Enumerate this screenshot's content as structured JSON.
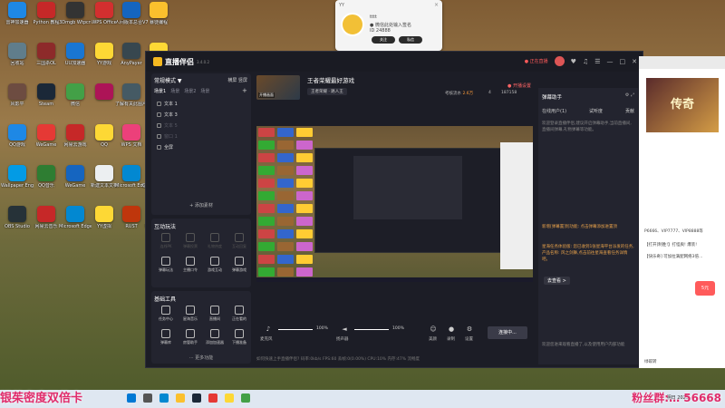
{
  "desktop_icons": [
    {
      "label": "雷神加速器",
      "color": "#1e88e5"
    },
    {
      "label": "Python 教程",
      "color": "#c62828"
    },
    {
      "label": "3Dmgb Wtpcn",
      "color": "#333333"
    },
    {
      "label": "WPS Office",
      "color": "#d32f2f"
    },
    {
      "label": "人间版本总合V7",
      "color": "#1565c0"
    },
    {
      "label": "暴徒编程",
      "color": "#fbc02d"
    },
    {
      "label": "回收站",
      "color": "#607d8b"
    },
    {
      "label": "三国杀OL",
      "color": "#8d2a2a"
    },
    {
      "label": "UU加速器",
      "color": "#1976d2"
    },
    {
      "label": "YY游戏",
      "color": "#fdd835"
    },
    {
      "label": "AnyPayer",
      "color": "#37474f"
    },
    {
      "label": "YY语音",
      "color": "#fdd835"
    },
    {
      "label": "风影平",
      "color": "#6d4c41"
    },
    {
      "label": "Steam",
      "color": "#1b2838"
    },
    {
      "label": "微信",
      "color": "#43a047"
    },
    {
      "label": "",
      "color": "#ad1457"
    },
    {
      "label": "了解有关此图片的信息",
      "color": "#455a64"
    },
    {
      "label": "哔哩哔",
      "color": "#e91e63"
    },
    {
      "label": "QQ游戏",
      "color": "#1e88e5"
    },
    {
      "label": "WeGame",
      "color": "#e53935"
    },
    {
      "label": "网易云游戏",
      "color": "#c62828"
    },
    {
      "label": "QQ",
      "color": "#fdd835"
    },
    {
      "label": "WPS 文档",
      "color": "#ec407a"
    },
    {
      "label": "PEAK",
      "color": "#5e35b1"
    },
    {
      "label": "Wallpaper Engine",
      "color": "#039be5"
    },
    {
      "label": "QQ音乐",
      "color": "#2e7d32"
    },
    {
      "label": "WeGame",
      "color": "#1565c0"
    },
    {
      "label": "新建文本文档",
      "color": "#eceff1"
    },
    {
      "label": "Microsoft Edge (2)",
      "color": "#0288d1"
    },
    {
      "label": "Goose Goose Duck",
      "color": "#6a1b9a"
    },
    {
      "label": "OBS Studio",
      "color": "#263238"
    },
    {
      "label": "网易云音乐",
      "color": "#c62828"
    },
    {
      "label": "Microsoft Edge",
      "color": "#0288d1"
    },
    {
      "label": "YY虚拟",
      "color": "#fdd835"
    },
    {
      "label": "RUST",
      "color": "#bf360c"
    },
    {
      "label": "新建文本文档",
      "color": "#eceff1"
    }
  ],
  "popup": {
    "title": "YY",
    "name": "tttt",
    "line1": "● 微信此处输入签名",
    "line2": "ID 24888",
    "btn1": "关注",
    "btn2": "私信",
    "close": "×"
  },
  "app": {
    "name": "直播伴侣",
    "version": "3.4.0.2",
    "go_live_top": "● 正在直播",
    "left": {
      "mode": "常规模式 ▼",
      "mode_right": "横屏  竖屏",
      "tabs": [
        "场景1",
        "场景",
        "场景2",
        "场景"
      ],
      "sources": [
        "文本 1",
        "文本 3",
        "文本 5",
        "窗口 1",
        "全屏"
      ],
      "add_source": "+ 添加素材",
      "interact_title": "互动玩法",
      "interact_more": "",
      "interact_tools": [
        "连线PK",
        "弹幕投票",
        "礼物热度",
        "互动回复",
        "弹幕玩法",
        "主播口令",
        "游戏互动",
        "弹幕游戏"
      ],
      "basic_title": "基础工具",
      "basic_tools": [
        "任务中心",
        "星海音乐",
        "直播间",
        "正在看的",
        "弹幕库",
        "房管助手",
        "添加加速器",
        "下播准备"
      ],
      "more_tools": "··· 更多功能"
    },
    "stream": {
      "title": "王者荣耀最好游戏",
      "tag1": "王者荣耀 · 路人王",
      "tag2": "",
      "thumb_label": "开播画面",
      "start_live": "● 开播设置",
      "share": "分享",
      "stat_label": "考核流水",
      "stat_value": "2.6万",
      "stat2": "4",
      "stat3": "187158"
    },
    "controls": {
      "mic_label": "麦克风",
      "mic_value": "100%",
      "speaker_label": "扬声器",
      "speaker_value": "100%",
      "effect_label": "美颜",
      "record_label": "录制",
      "settings_label": "设置",
      "live_button": "连接中..."
    },
    "statusbar": "如何快速上手直播伴侣?   码率:0kb/s   FPS:60   丢帧:0(0.00%)   CPU:10%   内存:47%   流畅度",
    "right": {
      "title": "弹幕助手",
      "tabs": [
        "在线用户(1)",
        "试听度",
        "贡献"
      ],
      "intro": "欢迎登录直播伴侣,建议开启弹幕助手,当前直播间,直播间弹幕,礼物弹幕等功能。",
      "notice1": "新增[弹幕置顶]功能: 点击弹幕添加进置顶",
      "notice2": "星海任务体验版: 您已收到1张星海平台派发的任务,产品名称: 风之剑舞,点击前往星海查看任务详情吧。",
      "goto": "去查看 >",
      "footer": "欢迎您进来观看直播了,以及使用用户内部功能"
    }
  },
  "browser": {
    "banner": "传奇",
    "line1": "P6666、VIP7777、VIP8888等",
    "line2": "【打开]制胜!】打怪爽! 爆装!",
    "line3": "【快乐奇] 可加拉满配网络3倍…",
    "red_badge": "5元",
    "status": "绿碳转"
  },
  "taskbar": {
    "clock": "明日 2023",
    "left_overlay": "银茱密度双倍卡",
    "right_overlay": "粉丝群:… 56668"
  }
}
